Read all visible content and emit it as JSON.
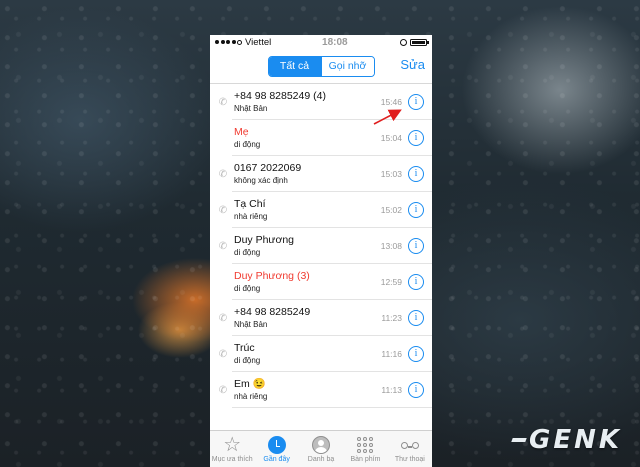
{
  "status": {
    "carrier": "Viettel",
    "time": "18:08"
  },
  "segment": {
    "all": "Tất cả",
    "missed": "Gọi nhỡ"
  },
  "edit_label": "Sửa",
  "calls": [
    {
      "name": "+84 98 8285249 (4)",
      "sub": "Nhật Bản",
      "time": "15:46",
      "missed": false
    },
    {
      "name": "Mẹ",
      "sub": "di động",
      "time": "15:04",
      "missed": true
    },
    {
      "name": "0167 2022069",
      "sub": "không xác định",
      "time": "15:03",
      "missed": false
    },
    {
      "name": "Tạ Chí",
      "sub": "nhà riêng",
      "time": "15:02",
      "missed": false
    },
    {
      "name": "Duy Phương",
      "sub": "di động",
      "time": "13:08",
      "missed": false
    },
    {
      "name": "Duy Phương (3)",
      "sub": "di động",
      "time": "12:59",
      "missed": true
    },
    {
      "name": "+84 98 8285249",
      "sub": "Nhật Bản",
      "time": "11:23",
      "missed": false
    },
    {
      "name": "Trúc",
      "sub": "di động",
      "time": "11:16",
      "missed": false
    },
    {
      "name": "Em 😉",
      "sub": "nhà riêng",
      "time": "11:13",
      "missed": false
    }
  ],
  "tabs": {
    "favorites": "Mục ưa thích",
    "recents": "Gần đây",
    "contacts": "Danh bạ",
    "keypad": "Bàn phím",
    "voicemail": "Thư thoại"
  },
  "watermark": "GENK",
  "colors": {
    "accent": "#1a8cf0",
    "missed": "#f03b30",
    "arrow": "#e01e1e"
  },
  "icons": {
    "call": "phone-outgoing-icon",
    "info": "info-circle-icon"
  }
}
